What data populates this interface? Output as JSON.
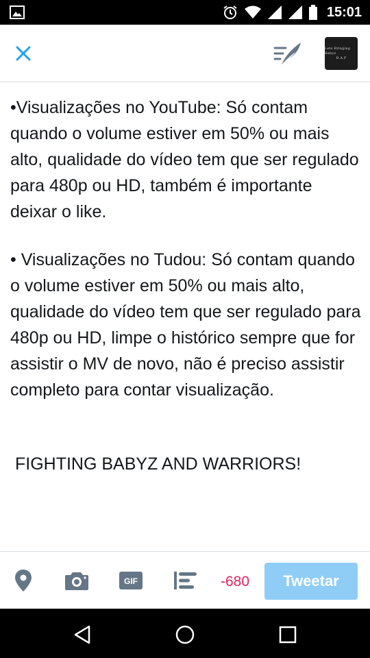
{
  "status_bar": {
    "time": "15:01",
    "icons": [
      "gallery-icon",
      "alarm-icon",
      "wifi-icon",
      "signal-icon",
      "signal-icon",
      "battery-icon"
    ]
  },
  "top_bar": {
    "close_icon": "close-icon",
    "drafts_icon": "drafts-icon",
    "avatar_text": [
      "Lets Bringing Babys",
      "B.A.P"
    ]
  },
  "compose": {
    "paragraphs": [
      "•Visualizações no YouTube: Só contam quando o volume estiver em 50% ou mais alto, qualidade do vídeo tem que ser regulado para 480p ou HD, também é importante deixar o like.",
      "• Visualizações no Tudou: Só contam quando o volume estiver em 50% ou mais alto, qualidade do vídeo tem que ser regulado para 480p ou HD, limpe o histórico sempre que for assistir o MV de novo, não é preciso assistir completo para contar visualização.",
      "FIGHTING BABYZ AND WARRIORS!"
    ]
  },
  "toolbar": {
    "tools": [
      "location-icon",
      "camera-icon",
      "gif-icon",
      "poll-icon"
    ],
    "gif_label": "GIF",
    "char_count": "-680",
    "tweet_label": "Tweetar"
  },
  "nav_bar": {
    "buttons": [
      "back-icon",
      "home-icon",
      "recents-icon"
    ]
  },
  "colors": {
    "accent": "#1da1f2",
    "tweet_button_disabled": "#8fcdf6",
    "char_count_over": "#e0245e",
    "icon_gray": "#657786"
  }
}
